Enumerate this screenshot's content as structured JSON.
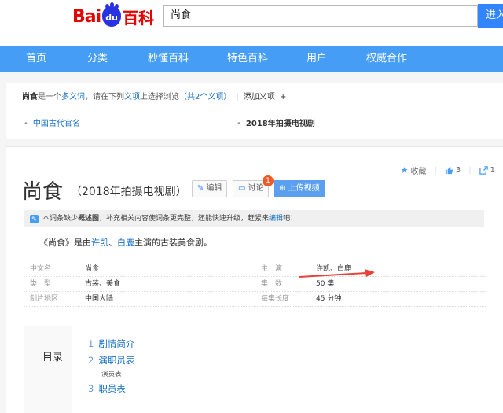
{
  "header": {
    "logo_bai": "Bai",
    "logo_du": "du",
    "logo_baike": "百科",
    "search_value": "尚食",
    "search_button": "进入"
  },
  "nav": [
    "首页",
    "分类",
    "秒懂百科",
    "特色百科",
    "用户",
    "权威合作"
  ],
  "polysemy": {
    "term": "尚食",
    "text1": "是一个",
    "link_word": "多义词",
    "text2": "，请在下列",
    "link_item": "义项",
    "text3": "上选择浏览",
    "count": "（共2个义项）",
    "add": "添加义项",
    "plus": "+",
    "items": [
      "中国古代官名",
      "2018年拍摄电视剧"
    ]
  },
  "tools": {
    "collect": "收藏",
    "like_count": "3",
    "share_count": "1"
  },
  "title": "尚食",
  "subtitle": "（2018年拍摄电视剧）",
  "buttons": {
    "edit": "编辑",
    "discuss": "讨论",
    "discuss_badge": "1",
    "upload": "上传视频"
  },
  "notice": {
    "text1": "本词条缺少",
    "bold": "概述图",
    "text2": "，补充相关内容使词条更完整，还能快速升级，赶紧来",
    "link": "编辑",
    "text3": "吧！"
  },
  "lemma": {
    "text1": "《尚食》是由",
    "actor1": "许凯",
    "sep": "、",
    "actor2": "白鹿",
    "text2": "主演的古装美食剧。"
  },
  "basic_info": [
    {
      "k1": "中文名",
      "v1": "尚食",
      "k2": "主　演",
      "v2": "许凯、白鹿"
    },
    {
      "k1": "类　型",
      "v1": "古装、美食",
      "k2": "集　数",
      "v2": "50 集"
    },
    {
      "k1": "制片地区",
      "v1": "中国大陆",
      "k2": "每集长度",
      "v2": "45 分钟"
    }
  ],
  "catalog": {
    "title": "目录",
    "items": [
      {
        "num": "1",
        "label": "剧情简介"
      },
      {
        "num": "2",
        "label": "演职员表"
      },
      {
        "num": "3",
        "label": "职员表"
      }
    ],
    "sub": "演员表"
  },
  "colors": {
    "nav": "#459df5",
    "link": "#136ec2",
    "badge": "#f05a26",
    "arrow": "#e8423a"
  },
  "icons": [
    "star-icon",
    "thumb-up-icon",
    "share-icon",
    "pencil-icon",
    "chat-icon",
    "upload-icon",
    "edit-notice-icon"
  ]
}
